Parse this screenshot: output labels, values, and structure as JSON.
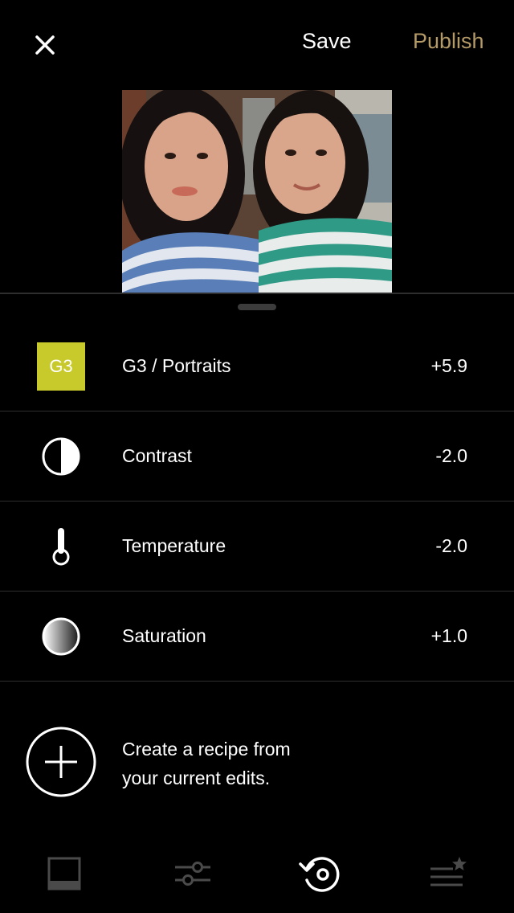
{
  "header": {
    "close_icon": "close-icon",
    "save_label": "Save",
    "publish_label": "Publish",
    "publish_color": "#b49a67"
  },
  "edits": [
    {
      "icon": "preset-badge",
      "badge_text": "G3",
      "badge_color": "#c8c92b",
      "label": "G3 / Portraits",
      "value": "+5.9"
    },
    {
      "icon": "contrast-icon",
      "label": "Contrast",
      "value": "-2.0"
    },
    {
      "icon": "thermometer-icon",
      "label": "Temperature",
      "value": "-2.0"
    },
    {
      "icon": "saturation-icon",
      "label": "Saturation",
      "value": "+1.0"
    }
  ],
  "recipe": {
    "icon": "add-circle-icon",
    "line1": "Create a recipe from",
    "line2": "your current edits."
  },
  "tabs": [
    {
      "icon": "presets-icon",
      "active": false
    },
    {
      "icon": "adjust-sliders-icon",
      "active": false
    },
    {
      "icon": "history-icon",
      "active": true
    },
    {
      "icon": "recipes-star-icon",
      "active": false
    }
  ]
}
